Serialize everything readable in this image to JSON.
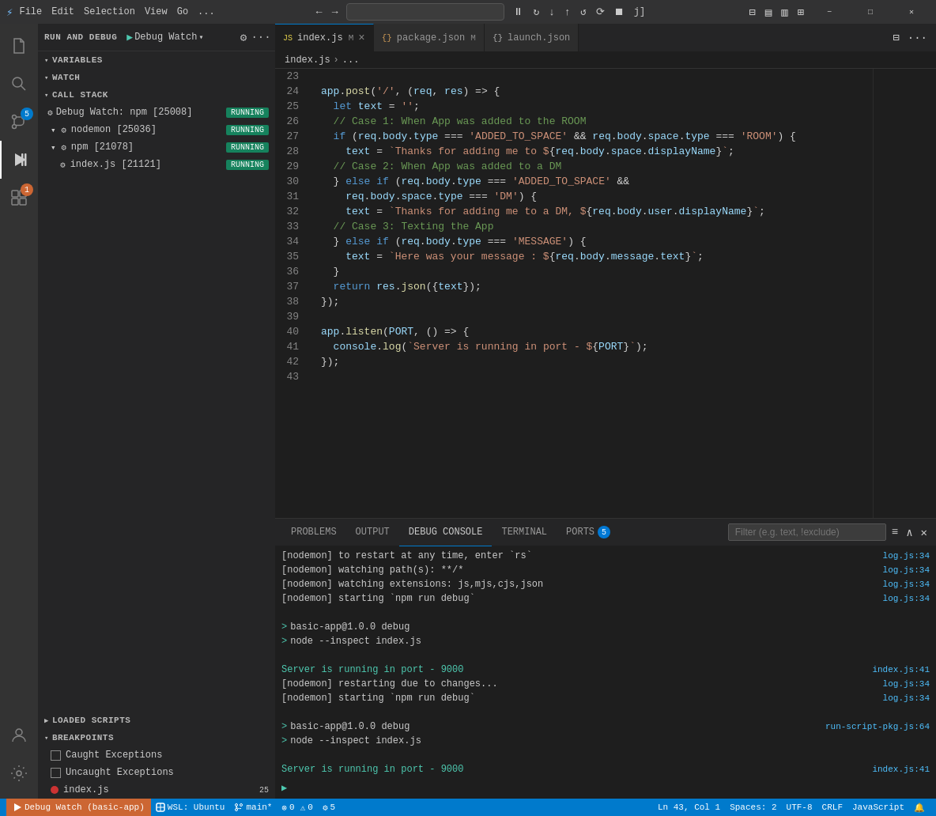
{
  "titleBar": {
    "icon": "⚡",
    "menu": [
      "File",
      "Edit",
      "Selection",
      "View",
      "Go",
      "..."
    ],
    "navBack": "←",
    "navForward": "→",
    "searchPlaceholder": "",
    "debugControls": [
      "⏸",
      "↻",
      "↓",
      "↑",
      "↺",
      "⟳",
      "⏹",
      "]"
    ],
    "configLabel": "Debug Watch",
    "winControls": [
      "−",
      "□",
      "✕"
    ]
  },
  "activityBar": {
    "icons": [
      {
        "name": "explorer-icon",
        "glyph": "⎘",
        "active": false
      },
      {
        "name": "search-icon",
        "glyph": "🔍",
        "active": false
      },
      {
        "name": "source-control-icon",
        "glyph": "⑂",
        "active": false,
        "badge": "5"
      },
      {
        "name": "run-debug-icon",
        "glyph": "▷",
        "active": true
      },
      {
        "name": "extensions-icon",
        "glyph": "⊞",
        "active": false,
        "badge": "1"
      }
    ],
    "bottomIcons": [
      {
        "name": "accounts-icon",
        "glyph": "◯"
      },
      {
        "name": "settings-icon",
        "glyph": "⚙"
      }
    ]
  },
  "sidebar": {
    "title": "RUN AND DEBUG",
    "configName": "Debug Watch",
    "sections": {
      "variables": {
        "label": "VARIABLES",
        "expanded": true
      },
      "watch": {
        "label": "WATCH",
        "expanded": true
      },
      "callStack": {
        "label": "CALL STACK",
        "expanded": true,
        "items": [
          {
            "level": 1,
            "icon": "⚙",
            "label": "Debug Watch: npm [25008]",
            "status": "RUNNING"
          },
          {
            "level": 2,
            "icon": "⚙",
            "label": "nodemon [25036]",
            "status": "RUNNING"
          },
          {
            "level": 2,
            "icon": "⚙",
            "label": "npm [21078]",
            "status": "RUNNING"
          },
          {
            "level": 3,
            "icon": "⚙",
            "label": "index.js [21121]",
            "status": "RUNNING"
          }
        ]
      },
      "loadedScripts": {
        "label": "LOADED SCRIPTS",
        "expanded": false
      },
      "breakpoints": {
        "label": "BREAKPOINTS",
        "expanded": true,
        "items": [
          {
            "label": "Caught Exceptions",
            "checked": false
          },
          {
            "label": "Uncaught Exceptions",
            "checked": false
          },
          {
            "label": "index.js",
            "isDot": true
          }
        ]
      }
    }
  },
  "tabs": [
    {
      "label": "index.js",
      "icon": "JS",
      "modified": true,
      "active": true,
      "closeable": true
    },
    {
      "label": "package.json",
      "icon": "{}",
      "modified": true,
      "active": false,
      "closeable": false
    },
    {
      "label": "launch.json",
      "icon": "{}",
      "modified": false,
      "active": false,
      "closeable": false
    }
  ],
  "breadcrumb": {
    "parts": [
      "index.js",
      "..."
    ]
  },
  "codeLines": [
    {
      "num": 23,
      "code": ""
    },
    {
      "num": 24,
      "code": "app.post('/', (req, res) => {",
      "colors": "app_post"
    },
    {
      "num": 25,
      "code": "  let text = '';",
      "breakpoint": true,
      "colors": "let_text"
    },
    {
      "num": 26,
      "code": "  // Case 1: When App was added to the ROOM",
      "colors": "comment"
    },
    {
      "num": 27,
      "code": "  if (req.body.type === 'ADDED_TO_SPACE' && req.body.space.type === 'ROOM') {",
      "colors": "if1"
    },
    {
      "num": 28,
      "code": "    text = `Thanks for adding me to ${req.body.space.displayName}`;",
      "colors": "tmpl1"
    },
    {
      "num": 29,
      "code": "  // Case 2: When App was added to a DM",
      "colors": "comment"
    },
    {
      "num": 30,
      "code": "  } else if (req.body.type === 'ADDED_TO_SPACE' &&",
      "colors": "elseif"
    },
    {
      "num": 31,
      "code": "    req.body.space.type === 'DM') {",
      "colors": "elseif2"
    },
    {
      "num": 32,
      "code": "    text = `Thanks for adding me to a DM, ${req.body.user.displayName}`;",
      "colors": "tmpl2"
    },
    {
      "num": 33,
      "code": "  // Case 3: Texting the App",
      "colors": "comment"
    },
    {
      "num": 34,
      "code": "  } else if (req.body.type === 'MESSAGE') {",
      "colors": "elseif3"
    },
    {
      "num": 35,
      "code": "    text = `Here was your message : ${req.body.message.text}`;",
      "colors": "tmpl3"
    },
    {
      "num": 36,
      "code": "  }",
      "colors": "brace"
    },
    {
      "num": 37,
      "code": "  return res.json({text});",
      "colors": "return"
    },
    {
      "num": 38,
      "code": "});",
      "colors": "brace"
    },
    {
      "num": 39,
      "code": ""
    },
    {
      "num": 40,
      "code": "app.listen(PORT, () => {",
      "colors": "listen"
    },
    {
      "num": 41,
      "code": "  console.log(`Server is running in port - ${PORT}`);",
      "colors": "console"
    },
    {
      "num": 42,
      "code": "});",
      "colors": "brace"
    },
    {
      "num": 43,
      "code": ""
    }
  ],
  "bottomPanel": {
    "tabs": [
      {
        "label": "PROBLEMS",
        "active": false
      },
      {
        "label": "OUTPUT",
        "active": false
      },
      {
        "label": "DEBUG CONSOLE",
        "active": true
      },
      {
        "label": "TERMINAL",
        "active": false
      },
      {
        "label": "PORTS",
        "active": false,
        "badge": "5"
      }
    ],
    "filterPlaceholder": "Filter (e.g. text, !exclude)",
    "consoleLines": [
      {
        "text": "[nodemon] to restart at any time, enter `rs`",
        "ref": "log.js:34",
        "type": "normal"
      },
      {
        "text": "[nodemon] watching path(s): **/*",
        "ref": "log.js:34",
        "type": "normal"
      },
      {
        "text": "[nodemon] watching extensions: js,mjs,cjs,json",
        "ref": "log.js:34",
        "type": "normal"
      },
      {
        "text": "[nodemon] starting `npm run debug`",
        "ref": "log.js:34",
        "type": "normal"
      },
      {
        "text": "",
        "type": "blank"
      },
      {
        "text": "> basic-app@1.0.0 debug",
        "ref": "",
        "type": "prompt"
      },
      {
        "text": "> node --inspect index.js",
        "ref": "",
        "type": "prompt"
      },
      {
        "text": "",
        "type": "blank"
      },
      {
        "text": "Server is running in port - 9000",
        "ref": "index.js:41",
        "type": "green"
      },
      {
        "text": "[nodemon] restarting due to changes...",
        "ref": "log.js:34",
        "type": "normal"
      },
      {
        "text": "[nodemon] starting `npm run debug`",
        "ref": "log.js:34",
        "type": "normal"
      },
      {
        "text": "",
        "type": "blank"
      },
      {
        "text": "> basic-app@1.0.0 debug",
        "ref": "run-script-pkg.js:64",
        "type": "prompt"
      },
      {
        "text": "> node --inspect index.js",
        "ref": "",
        "type": "prompt"
      },
      {
        "text": "",
        "type": "blank"
      },
      {
        "text": "Server is running in port - 9000",
        "ref": "index.js:41",
        "type": "green"
      }
    ],
    "promptChar": ">"
  },
  "statusBar": {
    "debugLabel": "Debug Watch (basic-app)",
    "gitBranch": "main*",
    "errors": "0",
    "warnings": "0",
    "debugSessions": "5",
    "position": "Ln 43, Col 1",
    "spaces": "Spaces: 2",
    "encoding": "UTF-8",
    "lineEnding": "CRLF",
    "language": "JavaScript",
    "wsl": "WSL: Ubuntu"
  }
}
